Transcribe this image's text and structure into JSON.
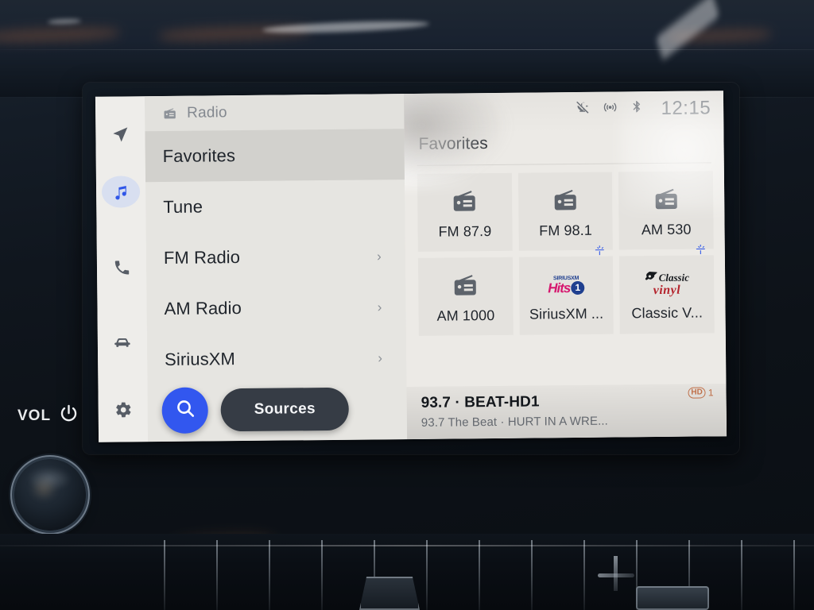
{
  "colors": {
    "accent_blue": "#2f56e8",
    "button_blue": "#3257ef",
    "sources_dark": "#363c45",
    "screen_bg": "#edece8",
    "tile_bg": "#e4e2de",
    "hd_orange": "#c2714a",
    "text_primary": "#1f242b",
    "text_muted": "#83888f"
  },
  "hardware": {
    "vol_label": "VOL",
    "power_icon": "power-icon",
    "volume_knob": "volume-knob"
  },
  "rail": {
    "items": [
      {
        "name": "navigation",
        "icon": "navigation-arrow-icon",
        "active": false
      },
      {
        "name": "media",
        "icon": "music-note-icon",
        "active": true
      },
      {
        "name": "phone",
        "icon": "phone-icon",
        "active": false
      },
      {
        "name": "vehicle",
        "icon": "car-icon",
        "active": false
      },
      {
        "name": "settings",
        "icon": "gear-icon",
        "active": false
      }
    ]
  },
  "source_panel": {
    "header": {
      "icon": "radio-icon",
      "title": "Radio"
    },
    "items": [
      {
        "label": "Favorites",
        "selected": true,
        "chevron": false
      },
      {
        "label": "Tune",
        "selected": false,
        "chevron": false
      },
      {
        "label": "FM Radio",
        "selected": false,
        "chevron": true
      },
      {
        "label": "AM Radio",
        "selected": false,
        "chevron": true
      },
      {
        "label": "SiriusXM",
        "selected": false,
        "chevron": true
      }
    ],
    "search_button": {
      "icon": "search-icon"
    },
    "sources_button": {
      "label": "Sources"
    }
  },
  "statusbar": {
    "icons": [
      {
        "name": "microphone-muted-icon",
        "glyph": "mic-muted"
      },
      {
        "name": "wireless-broadcast-icon",
        "glyph": "broadcast"
      },
      {
        "name": "bluetooth-icon",
        "glyph": "bluetooth"
      }
    ],
    "clock": "12:15"
  },
  "favorites": {
    "title": "Favorites",
    "tiles": [
      {
        "label": "FM 87.9",
        "art": "radio-icon",
        "satellite": false
      },
      {
        "label": "FM 98.1",
        "art": "radio-icon",
        "satellite": false
      },
      {
        "label": "AM 530",
        "art": "radio-icon",
        "satellite": false
      },
      {
        "label": "AM 1000",
        "art": "radio-icon",
        "satellite": false
      },
      {
        "label": "SiriusXM ...",
        "art": "siriusxm-hits1-logo",
        "satellite": true,
        "logo": {
          "brand": "SIRIUSXM",
          "name": "Hits",
          "channel": "1"
        }
      },
      {
        "label": "Classic V...",
        "art": "classic-vinyl-logo",
        "satellite": true,
        "logo": {
          "word1": "Classic",
          "word2": "vinyl"
        }
      }
    ]
  },
  "now_playing": {
    "title": "93.7 · BEAT-HD1",
    "subtitle": "93.7 The Beat · HURT IN A WRE...",
    "hd_badge": {
      "mark": "HD",
      "channel": "1"
    }
  }
}
